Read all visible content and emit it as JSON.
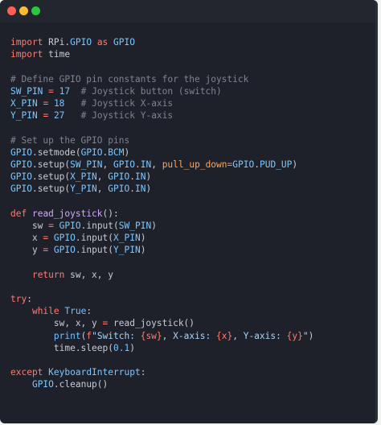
{
  "window": {
    "controls": [
      "close",
      "minimize",
      "maximize"
    ]
  },
  "code": {
    "lines": [
      [
        [
          "kw",
          "import"
        ],
        [
          "plain",
          " RPi."
        ],
        [
          "id",
          "GPIO"
        ],
        [
          "plain",
          " "
        ],
        [
          "kw",
          "as"
        ],
        [
          "plain",
          " "
        ],
        [
          "id",
          "GPIO"
        ]
      ],
      [
        [
          "kw",
          "import"
        ],
        [
          "plain",
          " time"
        ]
      ],
      [],
      [
        [
          "cm",
          "# Define GPIO pin constants for the joystick"
        ]
      ],
      [
        [
          "id",
          "SW_PIN"
        ],
        [
          "plain",
          " "
        ],
        [
          "op",
          "="
        ],
        [
          "plain",
          " "
        ],
        [
          "num",
          "17"
        ],
        [
          "plain",
          "  "
        ],
        [
          "cm",
          "# Joystick button (switch)"
        ]
      ],
      [
        [
          "id",
          "X_PIN"
        ],
        [
          "plain",
          " "
        ],
        [
          "op",
          "="
        ],
        [
          "plain",
          " "
        ],
        [
          "num",
          "18"
        ],
        [
          "plain",
          "   "
        ],
        [
          "cm",
          "# Joystick X-axis"
        ]
      ],
      [
        [
          "id",
          "Y_PIN"
        ],
        [
          "plain",
          " "
        ],
        [
          "op",
          "="
        ],
        [
          "plain",
          " "
        ],
        [
          "num",
          "27"
        ],
        [
          "plain",
          "   "
        ],
        [
          "cm",
          "# Joystick Y-axis"
        ]
      ],
      [],
      [
        [
          "cm",
          "# Set up the GPIO pins"
        ]
      ],
      [
        [
          "id",
          "GPIO"
        ],
        [
          "plain",
          ".setmode("
        ],
        [
          "id",
          "GPIO"
        ],
        [
          "plain",
          "."
        ],
        [
          "id",
          "BCM"
        ],
        [
          "plain",
          ")"
        ]
      ],
      [
        [
          "id",
          "GPIO"
        ],
        [
          "plain",
          ".setup("
        ],
        [
          "id",
          "SW_PIN"
        ],
        [
          "plain",
          ", "
        ],
        [
          "id",
          "GPIO"
        ],
        [
          "plain",
          "."
        ],
        [
          "id",
          "IN"
        ],
        [
          "plain",
          ", "
        ],
        [
          "param",
          "pull_up_down"
        ],
        [
          "op",
          "="
        ],
        [
          "id",
          "GPIO"
        ],
        [
          "plain",
          "."
        ],
        [
          "id",
          "PUD_UP"
        ],
        [
          "plain",
          ")"
        ]
      ],
      [
        [
          "id",
          "GPIO"
        ],
        [
          "plain",
          ".setup("
        ],
        [
          "id",
          "X_PIN"
        ],
        [
          "plain",
          ", "
        ],
        [
          "id",
          "GPIO"
        ],
        [
          "plain",
          "."
        ],
        [
          "id",
          "IN"
        ],
        [
          "plain",
          ")"
        ]
      ],
      [
        [
          "id",
          "GPIO"
        ],
        [
          "plain",
          ".setup("
        ],
        [
          "id",
          "Y_PIN"
        ],
        [
          "plain",
          ", "
        ],
        [
          "id",
          "GPIO"
        ],
        [
          "plain",
          "."
        ],
        [
          "id",
          "IN"
        ],
        [
          "plain",
          ")"
        ]
      ],
      [],
      [
        [
          "kw",
          "def"
        ],
        [
          "plain",
          " "
        ],
        [
          "fn",
          "read_joystick"
        ],
        [
          "plain",
          "():"
        ]
      ],
      [
        [
          "plain",
          "    sw "
        ],
        [
          "op",
          "="
        ],
        [
          "plain",
          " "
        ],
        [
          "id",
          "GPIO"
        ],
        [
          "plain",
          ".input("
        ],
        [
          "id",
          "SW_PIN"
        ],
        [
          "plain",
          ")"
        ]
      ],
      [
        [
          "plain",
          "    x "
        ],
        [
          "op",
          "="
        ],
        [
          "plain",
          " "
        ],
        [
          "id",
          "GPIO"
        ],
        [
          "plain",
          ".input("
        ],
        [
          "id",
          "X_PIN"
        ],
        [
          "plain",
          ")"
        ]
      ],
      [
        [
          "plain",
          "    y "
        ],
        [
          "op",
          "="
        ],
        [
          "plain",
          " "
        ],
        [
          "id",
          "GPIO"
        ],
        [
          "plain",
          ".input("
        ],
        [
          "id",
          "Y_PIN"
        ],
        [
          "plain",
          ")"
        ]
      ],
      [],
      [
        [
          "plain",
          "    "
        ],
        [
          "kw",
          "return"
        ],
        [
          "plain",
          " sw, x, y"
        ]
      ],
      [],
      [
        [
          "kw",
          "try"
        ],
        [
          "plain",
          ":"
        ]
      ],
      [
        [
          "plain",
          "    "
        ],
        [
          "kw",
          "while"
        ],
        [
          "plain",
          " "
        ],
        [
          "bi",
          "True"
        ],
        [
          "plain",
          ":"
        ]
      ],
      [
        [
          "plain",
          "        sw, x, y "
        ],
        [
          "op",
          "="
        ],
        [
          "plain",
          " read_joystick()"
        ]
      ],
      [
        [
          "plain",
          "        "
        ],
        [
          "bi",
          "print"
        ],
        [
          "plain",
          "("
        ],
        [
          "kw",
          "f"
        ],
        [
          "str",
          "\"Switch: "
        ],
        [
          "kw",
          "{sw}"
        ],
        [
          "str",
          ", X-axis: "
        ],
        [
          "kw",
          "{x}"
        ],
        [
          "str",
          ", Y-axis: "
        ],
        [
          "kw",
          "{y}"
        ],
        [
          "str",
          "\""
        ],
        [
          "plain",
          ")"
        ]
      ],
      [
        [
          "plain",
          "        time.sleep("
        ],
        [
          "num",
          "0.1"
        ],
        [
          "plain",
          ")"
        ]
      ],
      [],
      [
        [
          "kw",
          "except"
        ],
        [
          "plain",
          " "
        ],
        [
          "id",
          "KeyboardInterrupt"
        ],
        [
          "plain",
          ":"
        ]
      ],
      [
        [
          "plain",
          "    "
        ],
        [
          "id",
          "GPIO"
        ],
        [
          "plain",
          ".cleanup()"
        ]
      ]
    ]
  }
}
